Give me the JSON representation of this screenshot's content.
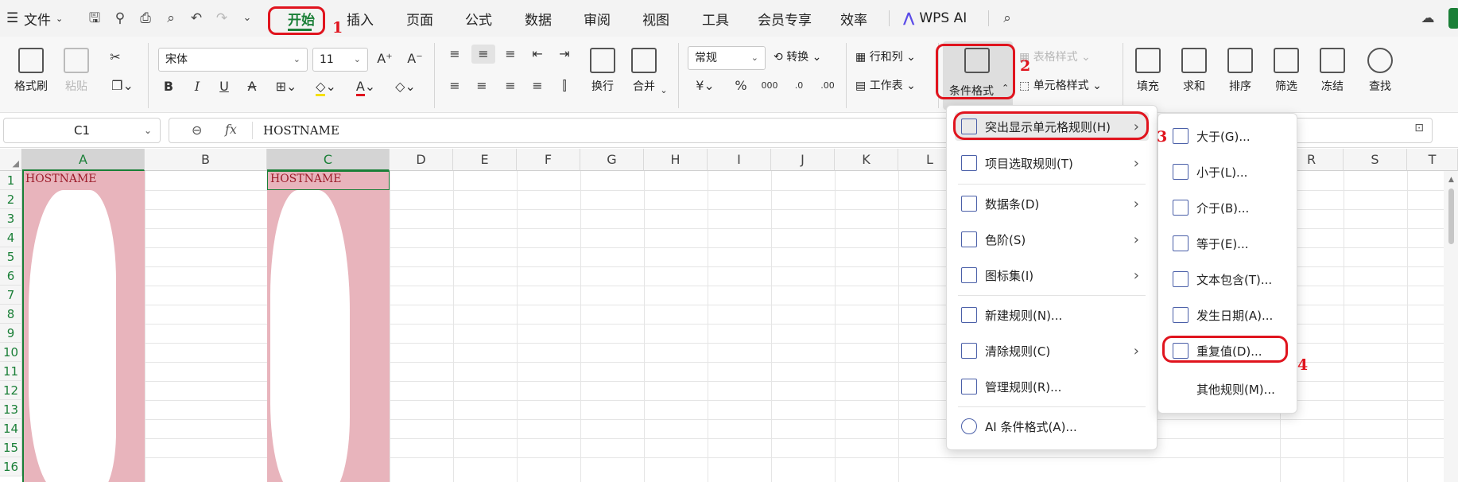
{
  "menubar": {
    "file_label": "文件",
    "tabs": [
      "开始",
      "插入",
      "页面",
      "公式",
      "数据",
      "审阅",
      "视图",
      "工具",
      "会员专享",
      "效率"
    ],
    "wps_ai_label": "WPS AI"
  },
  "ribbon": {
    "format_painter": "格式刷",
    "paste": "粘贴",
    "font_name": "宋体",
    "font_size": "11",
    "wrap_text": "换行",
    "merge": "合并",
    "number_format": "常规",
    "convert": "转换",
    "rows_cols": "行和列",
    "worksheet": "工作表",
    "conditional_format": "条件格式",
    "table_style": "表格样式",
    "cell_style": "单元格样式",
    "fill": "填充",
    "sum": "求和",
    "sort": "排序",
    "filter": "筛选",
    "freeze": "冻结",
    "find": "查找",
    "currency_symbol": "¥",
    "percent_symbol": "%",
    "thousands_symbol": "000"
  },
  "formula_bar": {
    "name_box": "C1",
    "fx_label": "fx",
    "content": "HOSTNAME"
  },
  "grid": {
    "columns": [
      "A",
      "B",
      "C",
      "D",
      "E",
      "F",
      "G",
      "H",
      "I",
      "J",
      "K",
      "L",
      "R",
      "S",
      "T"
    ],
    "rows": [
      "1",
      "2",
      "3",
      "4",
      "5",
      "6",
      "7",
      "8",
      "9",
      "10",
      "11",
      "12",
      "13",
      "14",
      "15",
      "16"
    ],
    "a1": "HOSTNAME",
    "c1": "HOSTNAME"
  },
  "cf_menu": {
    "items": [
      {
        "label": "突出显示单元格规则(H)"
      },
      {
        "label": "项目选取规则(T)"
      },
      {
        "label": "数据条(D)"
      },
      {
        "label": "色阶(S)"
      },
      {
        "label": "图标集(I)"
      },
      {
        "label": "新建规则(N)..."
      },
      {
        "label": "清除规则(C)"
      },
      {
        "label": "管理规则(R)..."
      },
      {
        "label": "AI 条件格式(A)..."
      }
    ]
  },
  "sub_menu": {
    "items": [
      {
        "label": "大于(G)..."
      },
      {
        "label": "小于(L)..."
      },
      {
        "label": "介于(B)..."
      },
      {
        "label": "等于(E)..."
      },
      {
        "label": "文本包含(T)..."
      },
      {
        "label": "发生日期(A)..."
      },
      {
        "label": "重复值(D)..."
      },
      {
        "label": "其他规则(M)..."
      }
    ]
  },
  "annotations": [
    "1",
    "2",
    "3",
    "4"
  ],
  "colors": {
    "accent": "#1a7f37",
    "annotation_red": "#e0141e",
    "duplicate_highlight": "#e8b4bc",
    "duplicate_text": "#9c1c2a"
  }
}
